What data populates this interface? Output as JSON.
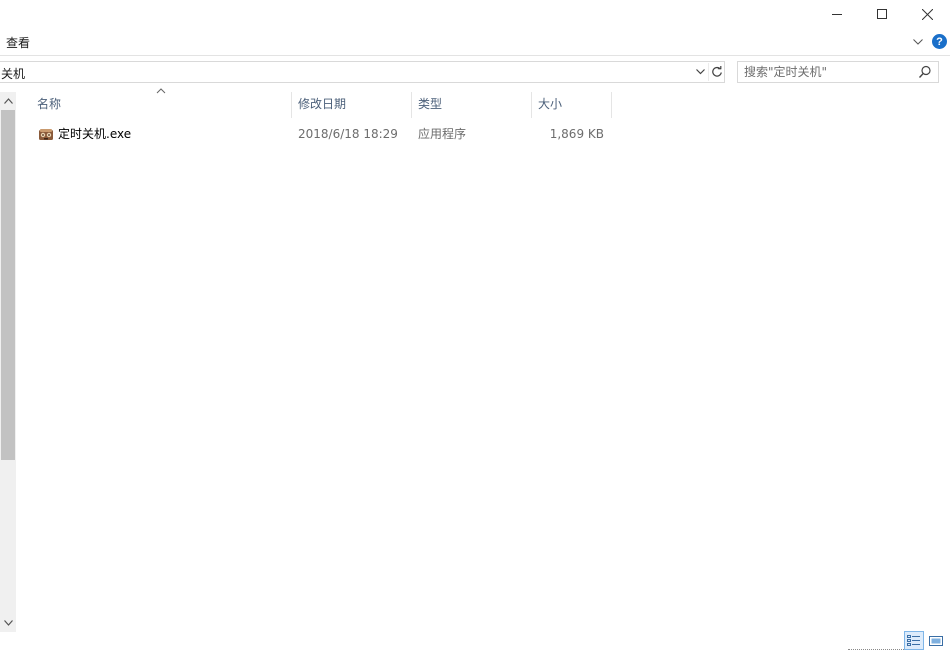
{
  "ribbon": {
    "view_tab_label": "查看",
    "help_label": "?"
  },
  "address": {
    "path": "关机"
  },
  "search": {
    "placeholder": "搜索\"定时关机\""
  },
  "columns": {
    "name": "名称",
    "date_modified": "修改日期",
    "type": "类型",
    "size": "大小"
  },
  "files": [
    {
      "name": "定时关机.exe",
      "date_modified": "2018/6/18 18:29",
      "type": "应用程序",
      "size": "1,869 KB",
      "icon": "application-exe-icon"
    }
  ],
  "icons": {
    "minimize": "minimize-icon",
    "maximize": "maximize-icon",
    "close": "close-icon",
    "expand_ribbon": "chevron-down-icon",
    "help": "help-icon",
    "refresh": "refresh-icon",
    "search": "search-icon",
    "sort": "sort-ascending-icon"
  },
  "colors": {
    "accent": "#1a6fc9",
    "column_header_text": "#4c607a",
    "scroll_thumb": "#c2c2c2"
  }
}
